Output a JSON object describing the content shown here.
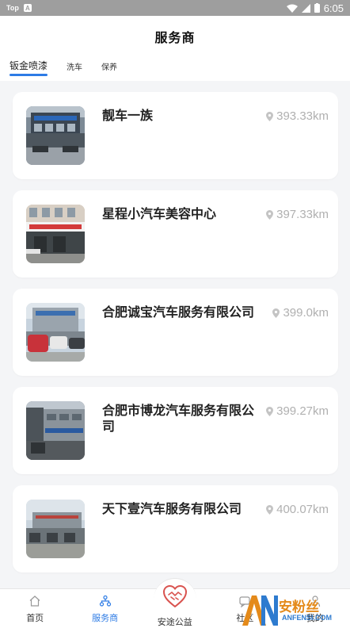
{
  "status_bar": {
    "app_tag": "Top",
    "notif_letter": "A",
    "time": "6:05"
  },
  "header": {
    "title": "服务商"
  },
  "tabs": [
    {
      "label": "钣金喷漆",
      "active": true
    },
    {
      "label": "洗车",
      "active": false
    },
    {
      "label": "保养",
      "active": false
    }
  ],
  "shops": [
    {
      "name": "靓车一族",
      "distance": "393.33km"
    },
    {
      "name": "星程小汽车美容中心",
      "distance": "397.33km"
    },
    {
      "name": "合肥诚宝汽车服务有限公司",
      "distance": "399.0km"
    },
    {
      "name": "合肥市博龙汽车服务有限公司",
      "distance": "399.27km"
    },
    {
      "name": "天下壹汽车服务有限公司",
      "distance": "400.07km"
    }
  ],
  "bottom_nav": [
    {
      "label": "首页",
      "icon": "home-icon"
    },
    {
      "label": "服务商",
      "icon": "service-provider-icon",
      "active": true
    },
    {
      "label": "安途公益",
      "icon": "charity-heart-icon"
    },
    {
      "label": "社区",
      "icon": "community-icon"
    },
    {
      "label": "我的",
      "icon": "profile-icon"
    }
  ],
  "watermark": {
    "text": "安粉丝",
    "sub": "ANFENSI.COM",
    "mark": "AN"
  },
  "colors": {
    "accent": "#2d7be5",
    "distance_gray": "#b0b0b0",
    "charity_red": "#d9534f"
  }
}
